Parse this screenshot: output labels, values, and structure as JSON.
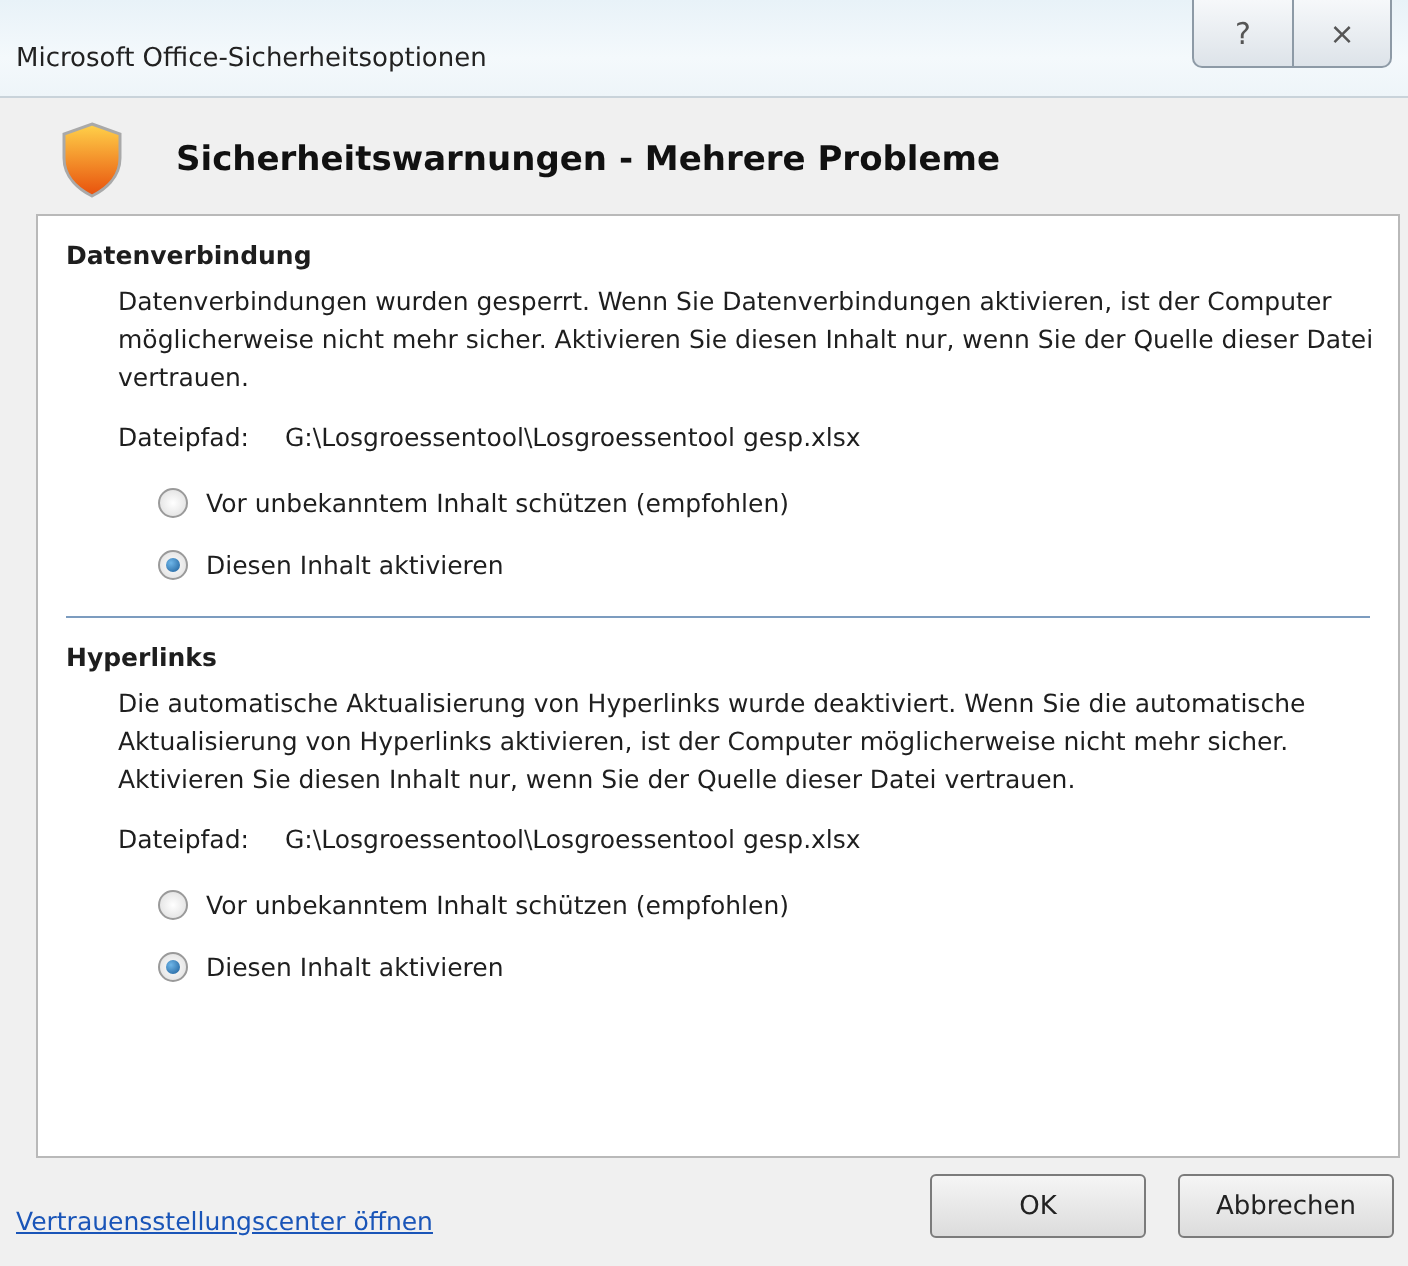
{
  "window": {
    "title": "Microsoft Office-Sicherheitsoptionen",
    "help_button": "?",
    "close_button": "×"
  },
  "header": {
    "title": "Sicherheitswarnungen - Mehrere Probleme"
  },
  "sections": [
    {
      "title": "Datenverbindung",
      "description": "Datenverbindungen wurden gesperrt. Wenn Sie Datenverbindungen aktivieren, ist der Computer möglicherweise nicht mehr sicher. Aktivieren Sie diesen Inhalt nur, wenn Sie der Quelle dieser Datei vertrauen.",
      "path_label": "Dateipfad:",
      "path": "G:\\Losgroessentool\\Losgroessentool gesp.xlsx",
      "options": [
        {
          "label": "Vor unbekanntem Inhalt schützen (empfohlen)",
          "selected": false
        },
        {
          "label": "Diesen Inhalt aktivieren",
          "selected": true
        }
      ]
    },
    {
      "title": "Hyperlinks",
      "description": "Die automatische Aktualisierung von Hyperlinks wurde deaktiviert. Wenn Sie die automatische Aktualisierung von Hyperlinks aktivieren, ist der Computer möglicherweise nicht mehr sicher. Aktivieren Sie diesen Inhalt nur, wenn Sie der Quelle dieser Datei vertrauen.",
      "path_label": "Dateipfad:",
      "path": "G:\\Losgroessentool\\Losgroessentool gesp.xlsx",
      "options": [
        {
          "label": "Vor unbekanntem Inhalt schützen (empfohlen)",
          "selected": false
        },
        {
          "label": "Diesen Inhalt aktivieren",
          "selected": true
        }
      ]
    }
  ],
  "footer": {
    "link": "Vertrauensstellungscenter öffnen",
    "buttons": [
      "OK",
      "Abbrechen"
    ]
  }
}
